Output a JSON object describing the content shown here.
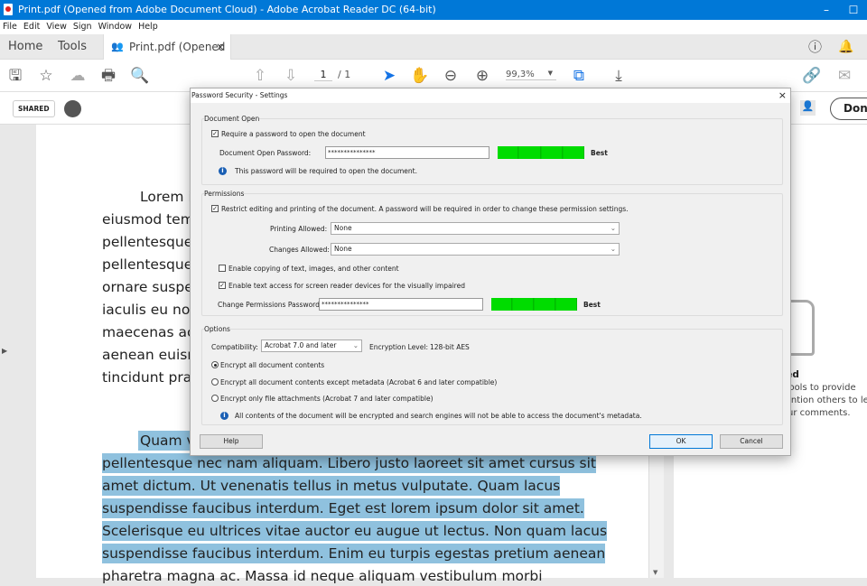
{
  "window": {
    "title": "Print.pdf (Opened from Adobe Document Cloud) - Adobe Acrobat Reader DC (64-bit)",
    "minimize": "–",
    "maximize": "☐"
  },
  "menu": [
    "File",
    "Edit",
    "View",
    "Sign",
    "Window",
    "Help"
  ],
  "tabs": {
    "home": "Home",
    "tools": "Tools",
    "doc": "Print.pdf (Opened f...",
    "close": "×"
  },
  "toolbar": {
    "page_current": "1",
    "page_total": "/ 1",
    "zoom": "99,3%"
  },
  "subbar": {
    "shared": "SHARED",
    "done": "Done"
  },
  "document": {
    "lines": [
      "Lorem i",
      "eiusmod tem",
      "pellentesque",
      "pellentesque",
      "ornare suspe",
      "iaculis eu nor",
      "maecenas ac",
      "aenean euism",
      "tincidunt pra"
    ],
    "highlight_lines": [
      "Quam v",
      "pellentesque nec nam aliquam. Libero justo laoreet sit amet cursus sit",
      "amet dictum. Ut venenatis tellus in metus vulputate. Quam lacus",
      "suspendisse faucibus interdum. Eget est lorem ipsum dolor sit amet.",
      "Scelerisque eu ultrices vitae auctor eu augue ut lectus. Non quam lacus",
      "suspendisse faucibus interdum. Enim eu turpis egestas pretium aenean"
    ],
    "last_line": "pharetra magna ac. Massa id neque aliquam vestibulum morbi"
  },
  "right_panel": {
    "heading": "rted",
    "lines": [
      "g tools to provide",
      "mention others to let",
      "your comments."
    ]
  },
  "dialog": {
    "title": "Password Security - Settings",
    "close": "×",
    "doc_open": {
      "group": "Document Open",
      "require_label": "Require a password to open the document",
      "require_checked": true,
      "password_label": "Document Open Password:",
      "password_value": "***************",
      "strength": "Best",
      "info": "This password will be required to open the document."
    },
    "permissions": {
      "group": "Permissions",
      "restrict_label": "Restrict editing and printing of the document. A password will be required in order to change these permission settings.",
      "restrict_checked": true,
      "printing_label": "Printing Allowed:",
      "printing_value": "None",
      "changes_label": "Changes Allowed:",
      "changes_value": "None",
      "copy_label": "Enable copying of text, images, and other content",
      "copy_checked": false,
      "screenreader_label": "Enable text access for screen reader devices for the visually impaired",
      "screenreader_checked": true,
      "password_label": "Change Permissions Password:",
      "password_value": "***************",
      "strength": "Best"
    },
    "options": {
      "group": "Options",
      "compat_label": "Compatibility:",
      "compat_value": "Acrobat 7.0 and later",
      "enc_label": "Encryption  Level:",
      "enc_value": "128-bit AES",
      "radios": [
        "Encrypt all document contents",
        "Encrypt all document contents except metadata (Acrobat 6 and later compatible)",
        "Encrypt only file attachments (Acrobat 7 and later compatible)"
      ],
      "selected_radio": 0,
      "info": "All contents of the document will be encrypted and search engines will not be able to access the document's metadata."
    },
    "buttons": {
      "help": "Help",
      "ok": "OK",
      "cancel": "Cancel"
    }
  },
  "colors": {
    "titlebar": "#0078d7",
    "highlight": "#8fc1de",
    "meter": "#00dc00",
    "accent": "#1473e6"
  }
}
